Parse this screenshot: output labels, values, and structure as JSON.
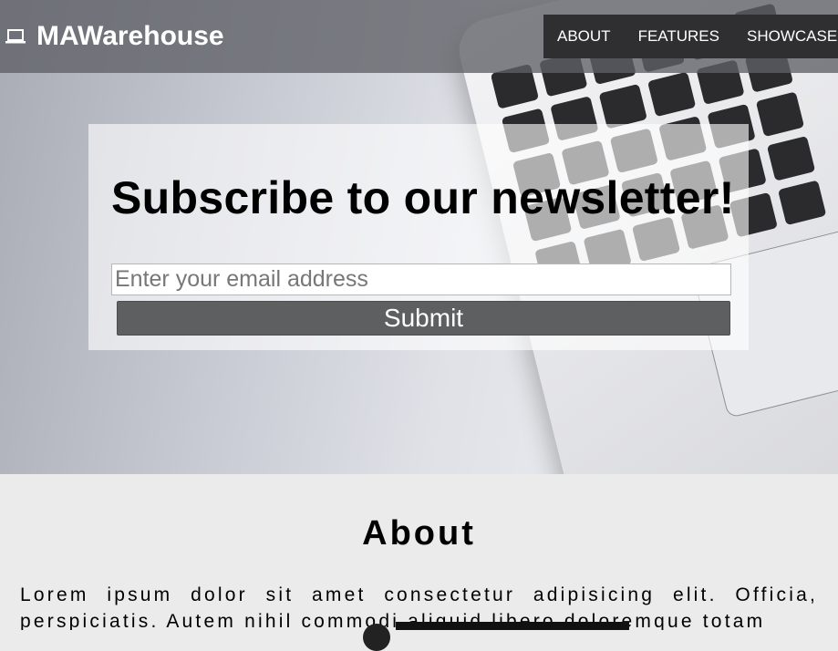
{
  "brand": {
    "name": "MAWarehouse",
    "icon": "laptop-icon"
  },
  "nav": {
    "items": [
      {
        "label": "ABOUT"
      },
      {
        "label": "FEATURES"
      },
      {
        "label": "SHOWCASE"
      }
    ]
  },
  "newsletter": {
    "title": "Subscribe to our newsletter!",
    "email_placeholder": "Enter your email address",
    "submit_label": "Submit"
  },
  "about": {
    "title": "About",
    "text": "Lorem ipsum dolor sit amet consectetur adipisicing elit. Officia, perspiciatis. Autem nihil commodi aliquid libero doloremque totam"
  },
  "colors": {
    "navbar": "#5f6066",
    "nav_links_bg": "#2f2f31",
    "submit_bg": "#5e5f61",
    "about_bg": "#ebebeb"
  }
}
